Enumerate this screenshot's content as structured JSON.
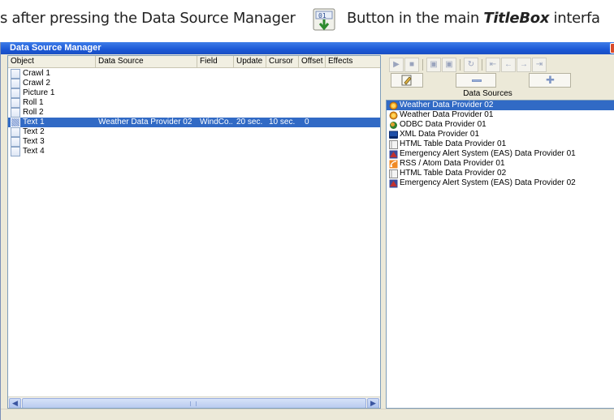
{
  "caption": {
    "part1": "s after pressing the Data Source Manager",
    "part2_a": "Button in the main ",
    "part2_b": "TitleBox",
    "part2_c": " interfa"
  },
  "window": {
    "title": "Data Source Manager"
  },
  "objects_table": {
    "columns": [
      "Object",
      "Data Source",
      "Field",
      "Update",
      "Cursor",
      "Offset",
      "Effects"
    ],
    "rows": [
      {
        "object": "Crawl 1",
        "data_source": "",
        "field": "",
        "update": "",
        "cursor": "",
        "offset": "",
        "selected": false
      },
      {
        "object": "Crawl 2",
        "data_source": "",
        "field": "",
        "update": "",
        "cursor": "",
        "offset": "",
        "selected": false
      },
      {
        "object": "Picture 1",
        "data_source": "",
        "field": "",
        "update": "",
        "cursor": "",
        "offset": "",
        "selected": false
      },
      {
        "object": "Roll 1",
        "data_source": "",
        "field": "",
        "update": "",
        "cursor": "",
        "offset": "",
        "selected": false
      },
      {
        "object": "Roll 2",
        "data_source": "",
        "field": "",
        "update": "",
        "cursor": "",
        "offset": "",
        "selected": false
      },
      {
        "object": "Text 1",
        "data_source": "Weather Data Provider 02",
        "field": "WindCo...",
        "update": "20 sec.",
        "cursor": "10 sec.",
        "offset": "0",
        "selected": true
      },
      {
        "object": "Text 2",
        "data_source": "",
        "field": "",
        "update": "",
        "cursor": "",
        "offset": "",
        "selected": false
      },
      {
        "object": "Text 3",
        "data_source": "",
        "field": "",
        "update": "",
        "cursor": "",
        "offset": "",
        "selected": false
      },
      {
        "object": "Text 4",
        "data_source": "",
        "field": "",
        "update": "",
        "cursor": "",
        "offset": "",
        "selected": false
      }
    ]
  },
  "data_sources": {
    "label": "Data Sources",
    "items": [
      {
        "label": "Weather Data Provider 02",
        "icon": "weather-icon",
        "selected": true
      },
      {
        "label": "Weather Data Provider 01",
        "icon": "weather-icon",
        "selected": false
      },
      {
        "label": "ODBC Data Provider 01",
        "icon": "database-icon",
        "selected": false
      },
      {
        "label": "XML Data Provider 01",
        "icon": "xml-icon",
        "selected": false
      },
      {
        "label": "HTML Table Data Provider 01",
        "icon": "html-table-icon",
        "selected": false
      },
      {
        "label": "Emergency Alert System (EAS) Data Provider 01",
        "icon": "alert-icon",
        "selected": false
      },
      {
        "label": "RSS / Atom Data Provider 01",
        "icon": "rss-icon",
        "selected": false
      },
      {
        "label": "HTML Table Data Provider 02",
        "icon": "html-table-icon",
        "selected": false
      },
      {
        "label": "Emergency Alert System (EAS) Data Provider 02",
        "icon": "alert-icon",
        "selected": false
      }
    ]
  },
  "colors": {
    "selection": "#316ac5",
    "titlebar": "#1b58d6",
    "window_bg": "#ece9d8"
  }
}
